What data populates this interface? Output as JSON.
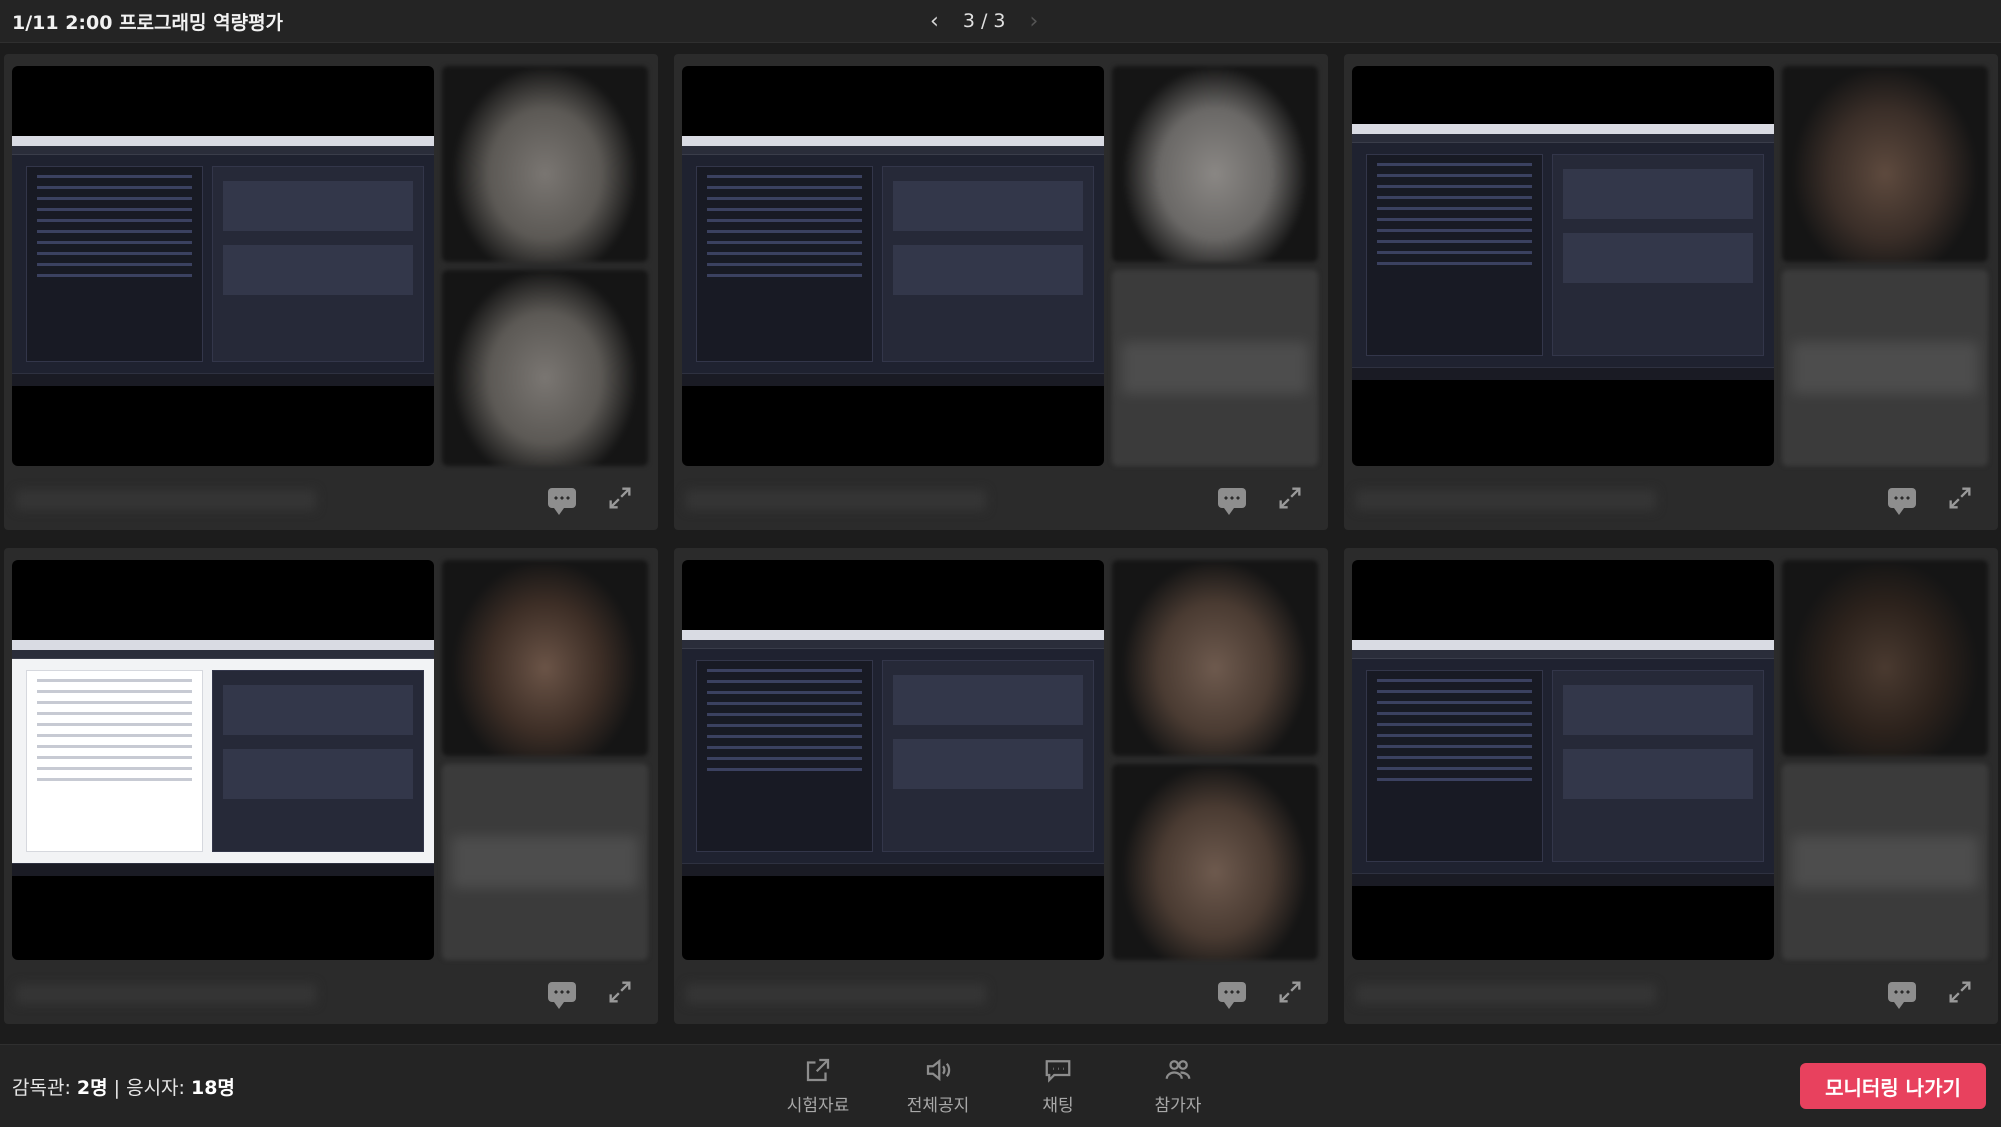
{
  "header": {
    "title": "1/11 2:00 프로그래밍 역량평가",
    "page_indicator": "3 / 3"
  },
  "panels": [
    {
      "screen": "dark",
      "cam_top": "face",
      "cam_bottom": "face"
    },
    {
      "screen": "dark",
      "cam_top": "face",
      "cam_bottom": "empty"
    },
    {
      "screen": "dark",
      "cam_top": "face",
      "cam_bottom": "empty"
    },
    {
      "screen": "light",
      "cam_top": "face",
      "cam_bottom": "empty"
    },
    {
      "screen": "dark",
      "cam_top": "face",
      "cam_bottom": "face"
    },
    {
      "screen": "dark",
      "cam_top": "face",
      "cam_bottom": "empty"
    }
  ],
  "footer": {
    "proctor_label": "감독관:",
    "proctor_count": "2명",
    "separator": "|",
    "examinee_label": "응시자:",
    "examinee_count": "18명",
    "tools": [
      {
        "label": "시험자료",
        "icon": "external-link-icon"
      },
      {
        "label": "전체공지",
        "icon": "speaker-icon"
      },
      {
        "label": "채팅",
        "icon": "chat-icon"
      },
      {
        "label": "참가자",
        "icon": "participants-icon"
      }
    ],
    "exit_button": "모니터링 나가기"
  },
  "colors": {
    "accent": "#e8415e",
    "panel": "#2b2b2b",
    "background": "#1c1c1c"
  }
}
